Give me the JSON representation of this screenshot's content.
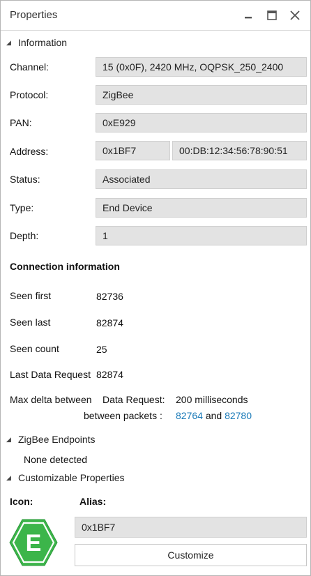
{
  "window": {
    "title": "Properties"
  },
  "information": {
    "header": "Information",
    "channel": {
      "label": "Channel:",
      "value": "15 (0x0F), 2420 MHz, OQPSK_250_2400"
    },
    "protocol": {
      "label": "Protocol:",
      "value": "ZigBee"
    },
    "pan": {
      "label": "PAN:",
      "value": "0xE929"
    },
    "address": {
      "label": "Address:",
      "short": "0x1BF7",
      "long": "00:DB:12:34:56:78:90:51"
    },
    "status": {
      "label": "Status:",
      "value": "Associated"
    },
    "type": {
      "label": "Type:",
      "value": "End Device"
    },
    "depth": {
      "label": "Depth:",
      "value": "1"
    }
  },
  "connection": {
    "header": "Connection information",
    "seen_first": {
      "label": "Seen first",
      "value": "82736"
    },
    "seen_last": {
      "label": "Seen last",
      "value": "82874"
    },
    "seen_count": {
      "label": "Seen count",
      "value": "25"
    },
    "last_data_request": {
      "label": "Last Data Request",
      "value": "82874"
    },
    "max_delta": {
      "label": "Max delta between",
      "sublabel1": "Data Request:",
      "value": "200 milliseconds",
      "sublabel2": "between packets :",
      "packet_a": "82764",
      "and": "and",
      "packet_b": "82780"
    }
  },
  "endpoints": {
    "header": "ZigBee Endpoints",
    "value": "None detected"
  },
  "custom": {
    "header": "Customizable Properties",
    "icon_label": "Icon:",
    "alias_label": "Alias:",
    "alias_value": "0x1BF7",
    "badge_letter": "E",
    "badge_color": "#3cb54a",
    "button": "Customize"
  },
  "colors": {
    "link": "#1a7ab8",
    "field_bg": "#e3e3e3"
  }
}
